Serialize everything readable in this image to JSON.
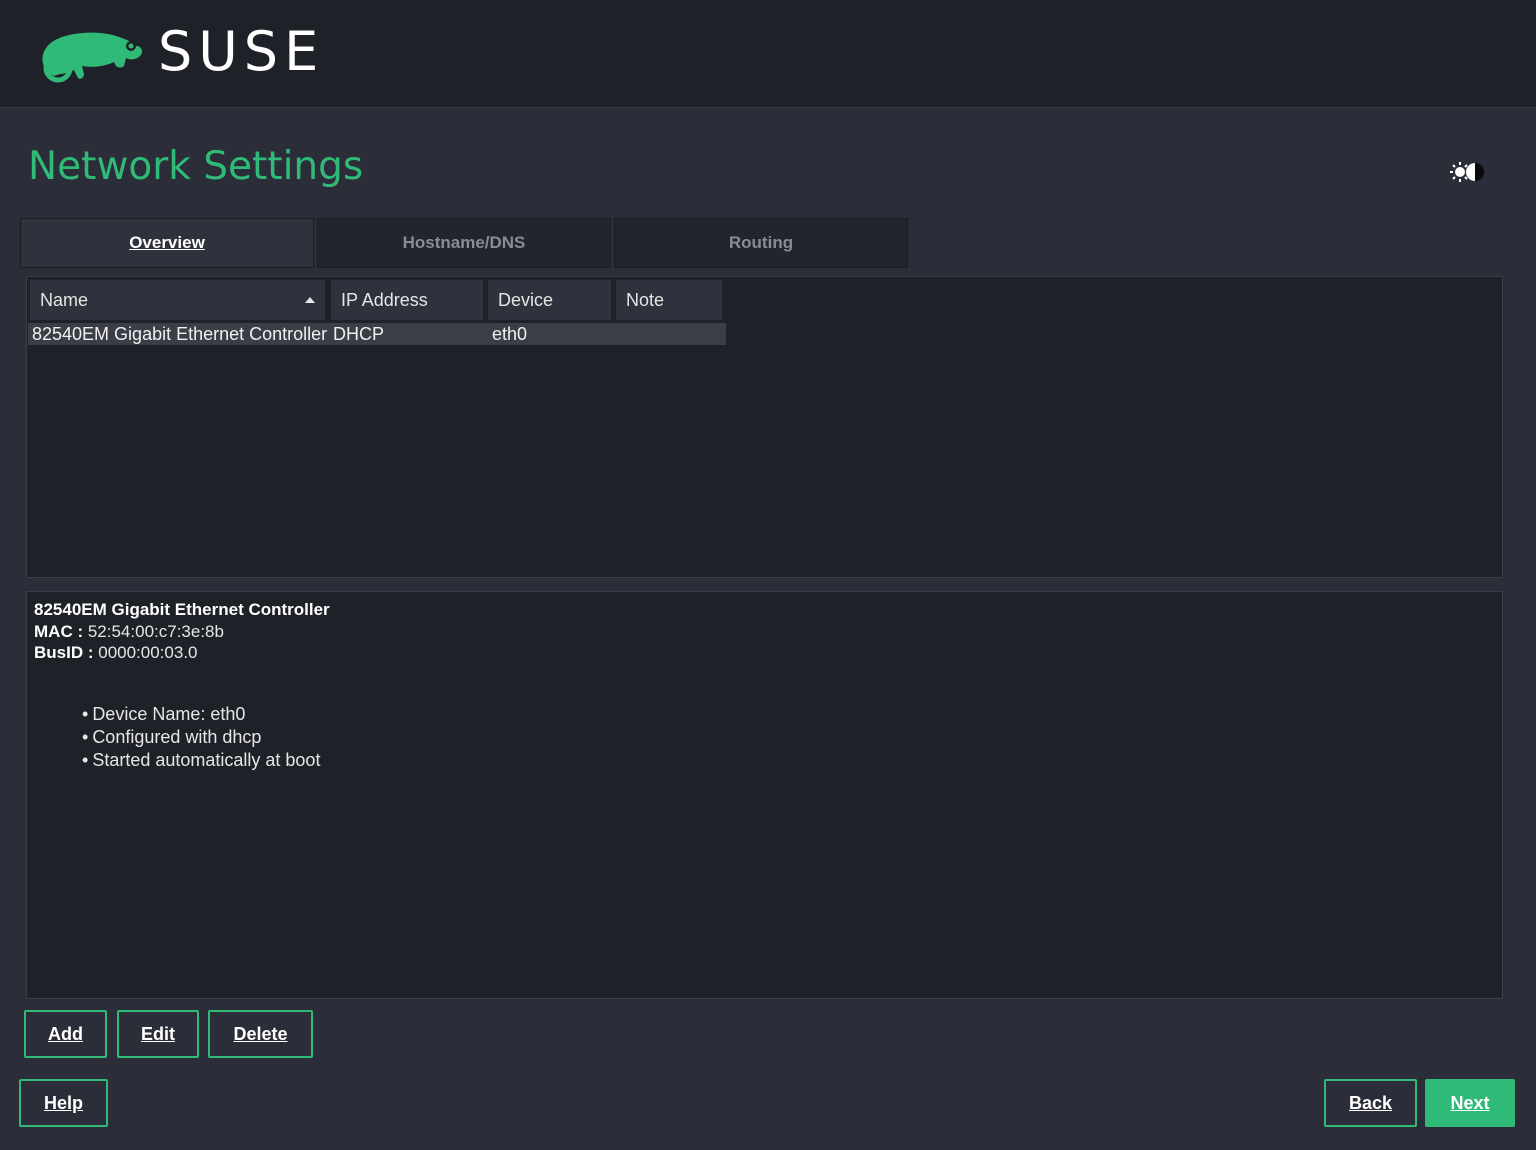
{
  "header": {
    "logo_text": "SUSE"
  },
  "page": {
    "title": "Network Settings"
  },
  "theme_toggle": {
    "icon": "sun-moon-icon"
  },
  "tabs": [
    {
      "label": "Overview",
      "active": true
    },
    {
      "label": "Hostname/DNS",
      "active": false
    },
    {
      "label": "Routing",
      "active": false
    }
  ],
  "table": {
    "columns": [
      "Name",
      "IP Address",
      "Device",
      "Note"
    ],
    "sort": {
      "column": "Name",
      "direction": "ascending"
    },
    "rows": [
      {
        "name": "82540EM Gigabit Ethernet Controller",
        "ip": "DHCP",
        "device": "eth0",
        "note": ""
      }
    ]
  },
  "details": {
    "title": "82540EM Gigabit Ethernet Controller",
    "mac_label": "MAC :",
    "mac_value": "52:54:00:c7:3e:8b",
    "busid_label": "BusID :",
    "busid_value": "0000:00:03.0",
    "bullets": [
      "Device Name: eth0",
      "Configured with dhcp",
      "Started automatically at boot"
    ]
  },
  "buttons": {
    "add": "Add",
    "edit": "Edit",
    "delete": "Delete",
    "help": "Help",
    "back": "Back",
    "next": "Next"
  },
  "colors": {
    "accent": "#30ba78",
    "background": "#2b2e38",
    "panel": "#1f2129",
    "header": "#1f2129"
  }
}
